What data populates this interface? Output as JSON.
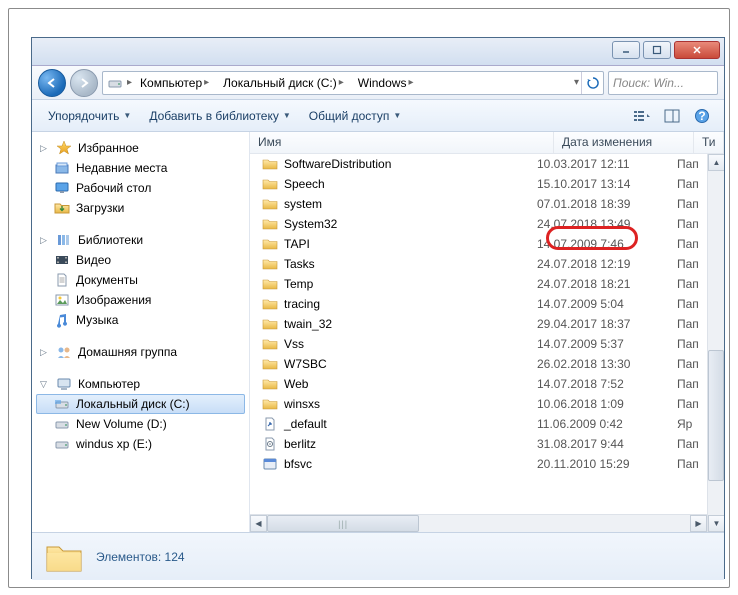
{
  "window_buttons": {
    "min": "—",
    "max": "▢",
    "close": "✕"
  },
  "breadcrumbs": [
    "Компьютер",
    "Локальный диск (C:)",
    "Windows"
  ],
  "search_placeholder": "Поиск: Win...",
  "toolbar": {
    "organize": "Упорядочить",
    "library": "Добавить в библиотеку",
    "share": "Общий доступ"
  },
  "sidebar": {
    "favorites": {
      "label": "Избранное",
      "items": [
        "Недавние места",
        "Рабочий стол",
        "Загрузки"
      ]
    },
    "libraries": {
      "label": "Библиотеки",
      "items": [
        "Видео",
        "Документы",
        "Изображения",
        "Музыка"
      ]
    },
    "homegroup": {
      "label": "Домашняя группа"
    },
    "computer": {
      "label": "Компьютер",
      "items": [
        "Локальный диск (C:)",
        "New Volume (D:)",
        "windus xp (E:)"
      ]
    }
  },
  "columns": {
    "name": "Имя",
    "date": "Дата изменения",
    "type": "Ти"
  },
  "files": [
    {
      "name": "SoftwareDistribution",
      "date": "10.03.2017 12:11",
      "type": "Пап",
      "icon": "folder"
    },
    {
      "name": "Speech",
      "date": "15.10.2017 13:14",
      "type": "Пап",
      "icon": "folder"
    },
    {
      "name": "system",
      "date": "07.01.2018 18:39",
      "type": "Пап",
      "icon": "folder"
    },
    {
      "name": "System32",
      "date": "24.07.2018 13:49",
      "type": "Пап",
      "icon": "folder"
    },
    {
      "name": "TAPI",
      "date": "14.07.2009 7:46",
      "type": "Пап",
      "icon": "folder"
    },
    {
      "name": "Tasks",
      "date": "24.07.2018 12:19",
      "type": "Пап",
      "icon": "folder"
    },
    {
      "name": "Temp",
      "date": "24.07.2018 18:21",
      "type": "Пап",
      "icon": "folder"
    },
    {
      "name": "tracing",
      "date": "14.07.2009 5:04",
      "type": "Пап",
      "icon": "folder"
    },
    {
      "name": "twain_32",
      "date": "29.04.2017 18:37",
      "type": "Пап",
      "icon": "folder"
    },
    {
      "name": "Vss",
      "date": "14.07.2009 5:37",
      "type": "Пап",
      "icon": "folder"
    },
    {
      "name": "W7SBC",
      "date": "26.02.2018 13:30",
      "type": "Пап",
      "icon": "folder"
    },
    {
      "name": "Web",
      "date": "14.07.2018 7:52",
      "type": "Пап",
      "icon": "folder"
    },
    {
      "name": "winsxs",
      "date": "10.06.2018 1:09",
      "type": "Пап",
      "icon": "folder"
    },
    {
      "name": "_default",
      "date": "11.06.2009 0:42",
      "type": "Яр",
      "icon": "file-pif"
    },
    {
      "name": "berlitz",
      "date": "31.08.2017 9:44",
      "type": "Пап",
      "icon": "file-ini"
    },
    {
      "name": "bfsvc",
      "date": "20.11.2010 15:29",
      "type": "Пап",
      "icon": "file-exe"
    }
  ],
  "status": {
    "count_label": "Элементов: 124"
  }
}
